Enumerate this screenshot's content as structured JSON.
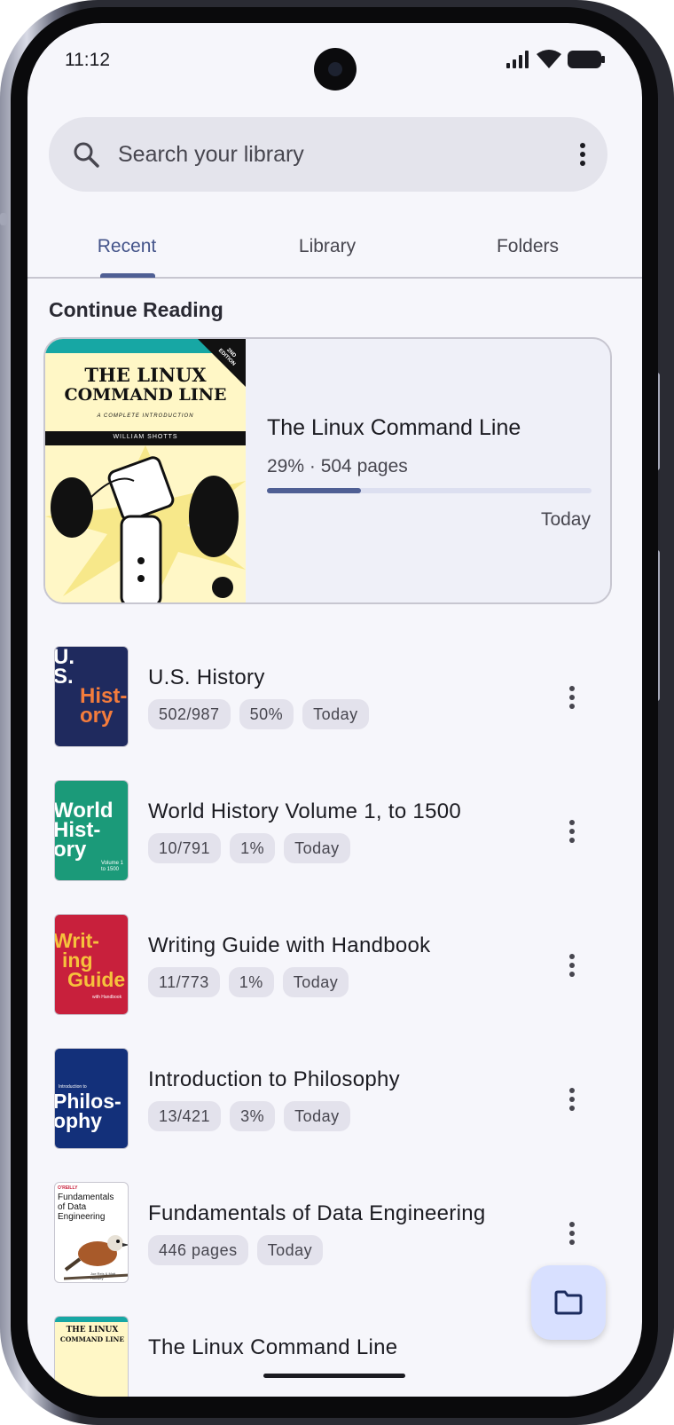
{
  "status_bar": {
    "time": "11:12"
  },
  "search": {
    "placeholder": "Search your library"
  },
  "tabs": [
    {
      "label": "Recent",
      "active": true
    },
    {
      "label": "Library",
      "active": false
    },
    {
      "label": "Folders",
      "active": false
    }
  ],
  "section_title": "Continue Reading",
  "continue_reading": {
    "title": "The Linux Command Line",
    "progress_text": "29% · 504 pages",
    "progress": 0.29,
    "date": "Today",
    "cover": {
      "line1": "THE LINUX",
      "line2": "COMMAND LINE",
      "subtitle": "A COMPLETE INTRODUCTION",
      "author": "WILLIAM SHOTTS",
      "badge": "2ND EDITION"
    }
  },
  "books": [
    {
      "title": "U.S. History",
      "chips": [
        "502/987",
        "50%",
        "Today"
      ],
      "cover": {
        "text": [
          "U.",
          "S.",
          "Hist-",
          "ory"
        ],
        "bg": "#1f2a5e",
        "accent": "#f47c3c"
      }
    },
    {
      "title": "World History Volume 1, to 1500",
      "chips": [
        "10/791",
        "1%",
        "Today"
      ],
      "cover": {
        "text": [
          "World",
          "Hist-",
          "ory"
        ],
        "bg": "#1b9a79",
        "caption": "Volume 1 to 1500"
      }
    },
    {
      "title": "Writing Guide with Handbook",
      "chips": [
        "11/773",
        "1%",
        "Today"
      ],
      "cover": {
        "text": [
          "Writ-",
          "ing",
          "Guide"
        ],
        "bg": "#c8203c",
        "accent": "#f6c23c",
        "caption": "with Handbook"
      }
    },
    {
      "title": "Introduction to Philosophy",
      "chips": [
        "13/421",
        "3%",
        "Today"
      ],
      "cover": {
        "text": [
          "Philos-",
          "ophy"
        ],
        "bg": "#13307a",
        "caption": "Introduction to"
      }
    },
    {
      "title": "Fundamentals of Data Engineering",
      "chips": [
        "446 pages",
        "Today"
      ],
      "cover": {
        "text": [
          "Fundamentals",
          "of Data",
          "Engineering"
        ],
        "bg": "#ffffff",
        "publisher": "O'REILLY",
        "authors": "Joe Reis & Matt Housley"
      }
    },
    {
      "title": "The Linux Command Line",
      "chips": [],
      "cover": {
        "text": [
          "THE LINUX",
          "COMMAND LINE"
        ],
        "bg": "#fff7c6"
      }
    }
  ],
  "colors": {
    "primary": "#4f5f94",
    "surface": "#f6f6fb",
    "fab": "#d8e0ff"
  }
}
